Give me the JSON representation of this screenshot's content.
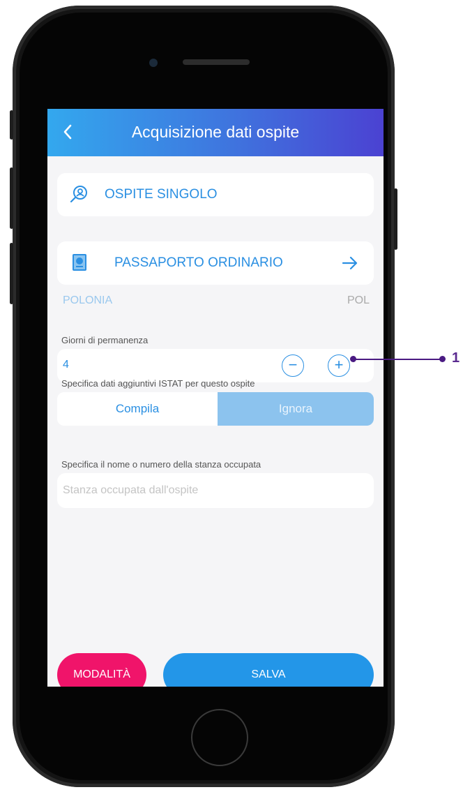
{
  "header": {
    "title": "Acquisizione dati ospite",
    "back_icon": "chevron-left-icon"
  },
  "guest_type": {
    "label": "OSPITE SINGOLO",
    "icon": "user-search-icon"
  },
  "document": {
    "label": "PASSAPORTO ORDINARIO",
    "icon": "passport-icon",
    "arrow_icon": "arrow-right-icon"
  },
  "country": {
    "name": "POLONIA",
    "code": "POL"
  },
  "stay": {
    "label": "Giorni di permanenza",
    "value": "4",
    "minus": "−",
    "plus": "+"
  },
  "istat": {
    "label": "Specifica dati aggiuntivi ISTAT per questo ospite",
    "option_fill": "Compila",
    "option_ignore": "Ignora",
    "selected": "Ignora"
  },
  "room": {
    "label": "Specifica il nome o numero della stanza occupata",
    "placeholder": "Stanza occupata dall'ospite"
  },
  "footer": {
    "mode_label": "MODALITÀ",
    "save_label": "SALVA"
  },
  "annotation": {
    "number": "1"
  },
  "colors": {
    "accent": "#2a8fe2",
    "mode_button": "#f0146a",
    "save_button": "#2396e8",
    "header_start": "#33a8ee",
    "header_end": "#4b42d2"
  }
}
